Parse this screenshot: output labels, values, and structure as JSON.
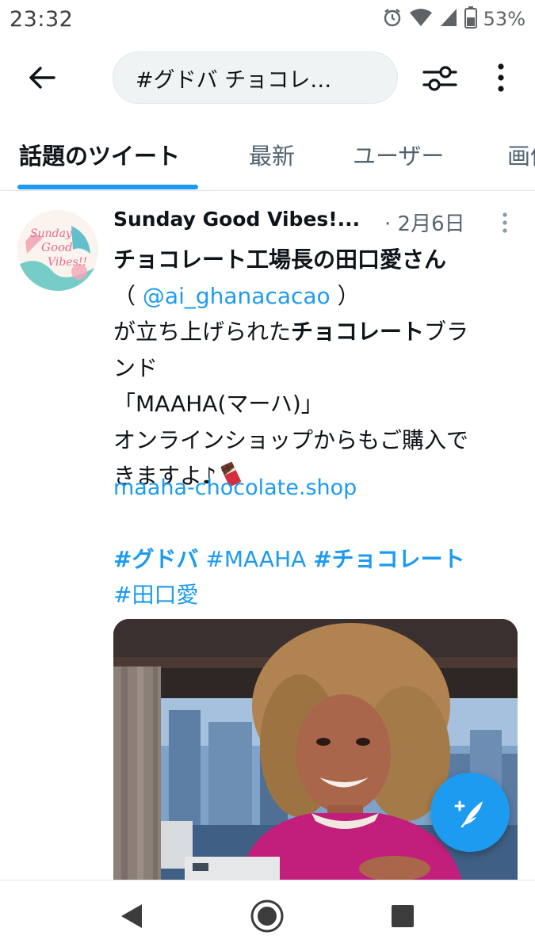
{
  "status_bar": {
    "time": "23:32",
    "battery_percent": "53%",
    "icons": [
      "alarm-icon",
      "wifi-icon",
      "cell-signal-icon",
      "battery-icon"
    ]
  },
  "app_bar": {
    "search_query": "#グドバ チョコレ…",
    "icons": [
      "back-arrow-icon",
      "filter-sliders-icon",
      "more-vertical-icon"
    ]
  },
  "tabs": [
    {
      "label": "話題のツイート",
      "active": true
    },
    {
      "label": "最新",
      "active": false
    },
    {
      "label": "ユーザー",
      "active": false
    },
    {
      "label": "画像",
      "active": false
    }
  ],
  "tweet": {
    "author_name": "Sunday Good Vibes!...",
    "date": "· 2月6日",
    "body": {
      "line1": "チョコレート工場長の田口愛さん",
      "line2_open": "（ ",
      "mention": "@ai_ghanacacao",
      "line2_close": " ）",
      "line3_pre": "が立ち上げられた",
      "line3_bold": "チョコレート",
      "line3_post": "ブラ",
      "line4": "ンド",
      "line5": "「MAAHA(マーハ)」",
      "line6": "オンラインショップからもご購入で",
      "line7": "きますよ♪"
    },
    "url": "maaha-chocolate.shop",
    "hashtags": {
      "tag1": "#グドバ",
      "tag2": "#MAAHA",
      "tag3": "#チョコレート",
      "tag4": "#田口愛"
    },
    "avatar_text": {
      "line1": "Sunday",
      "line2": "Good",
      "line3": "Vibes!!"
    }
  },
  "colors": {
    "accent": "#1d9bf0",
    "text_primary": "#0f1419",
    "text_secondary": "#536471"
  },
  "nav_bar": {
    "icons": [
      "back-triangle-icon",
      "home-circle-icon",
      "recents-square-icon"
    ]
  }
}
